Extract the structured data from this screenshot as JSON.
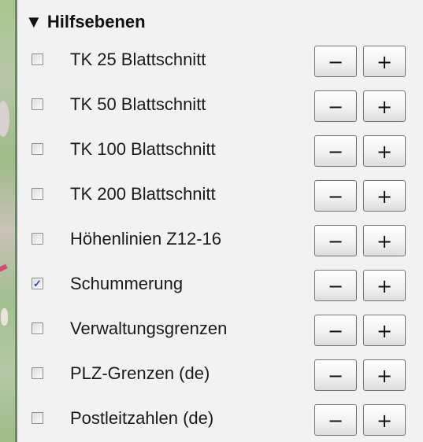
{
  "panel": {
    "title": "▼ Hilfsebenen",
    "layers": [
      {
        "label": "TK 25 Blattschnitt",
        "checked": false
      },
      {
        "label": "TK 50 Blattschnitt",
        "checked": false
      },
      {
        "label": "TK 100 Blattschnitt",
        "checked": false
      },
      {
        "label": "TK 200 Blattschnitt",
        "checked": false
      },
      {
        "label": "Höhenlinien Z12-16",
        "checked": false
      },
      {
        "label": "Schummerung",
        "checked": true,
        "check_mark": "✓"
      },
      {
        "label": "Verwaltungsgrenzen",
        "checked": false
      },
      {
        "label": "PLZ-Grenzen (de)",
        "checked": false
      },
      {
        "label": "Postleitzahlen (de)",
        "checked": false
      }
    ],
    "minus_label": "−",
    "plus_label": "+"
  },
  "colors": {
    "panel_background": "#f2f2f2",
    "check_mark": "#2b4ea8",
    "panel_border": "#6a876c"
  },
  "icons": {
    "checkbox": "checkbox-icon",
    "check": "check-icon"
  }
}
